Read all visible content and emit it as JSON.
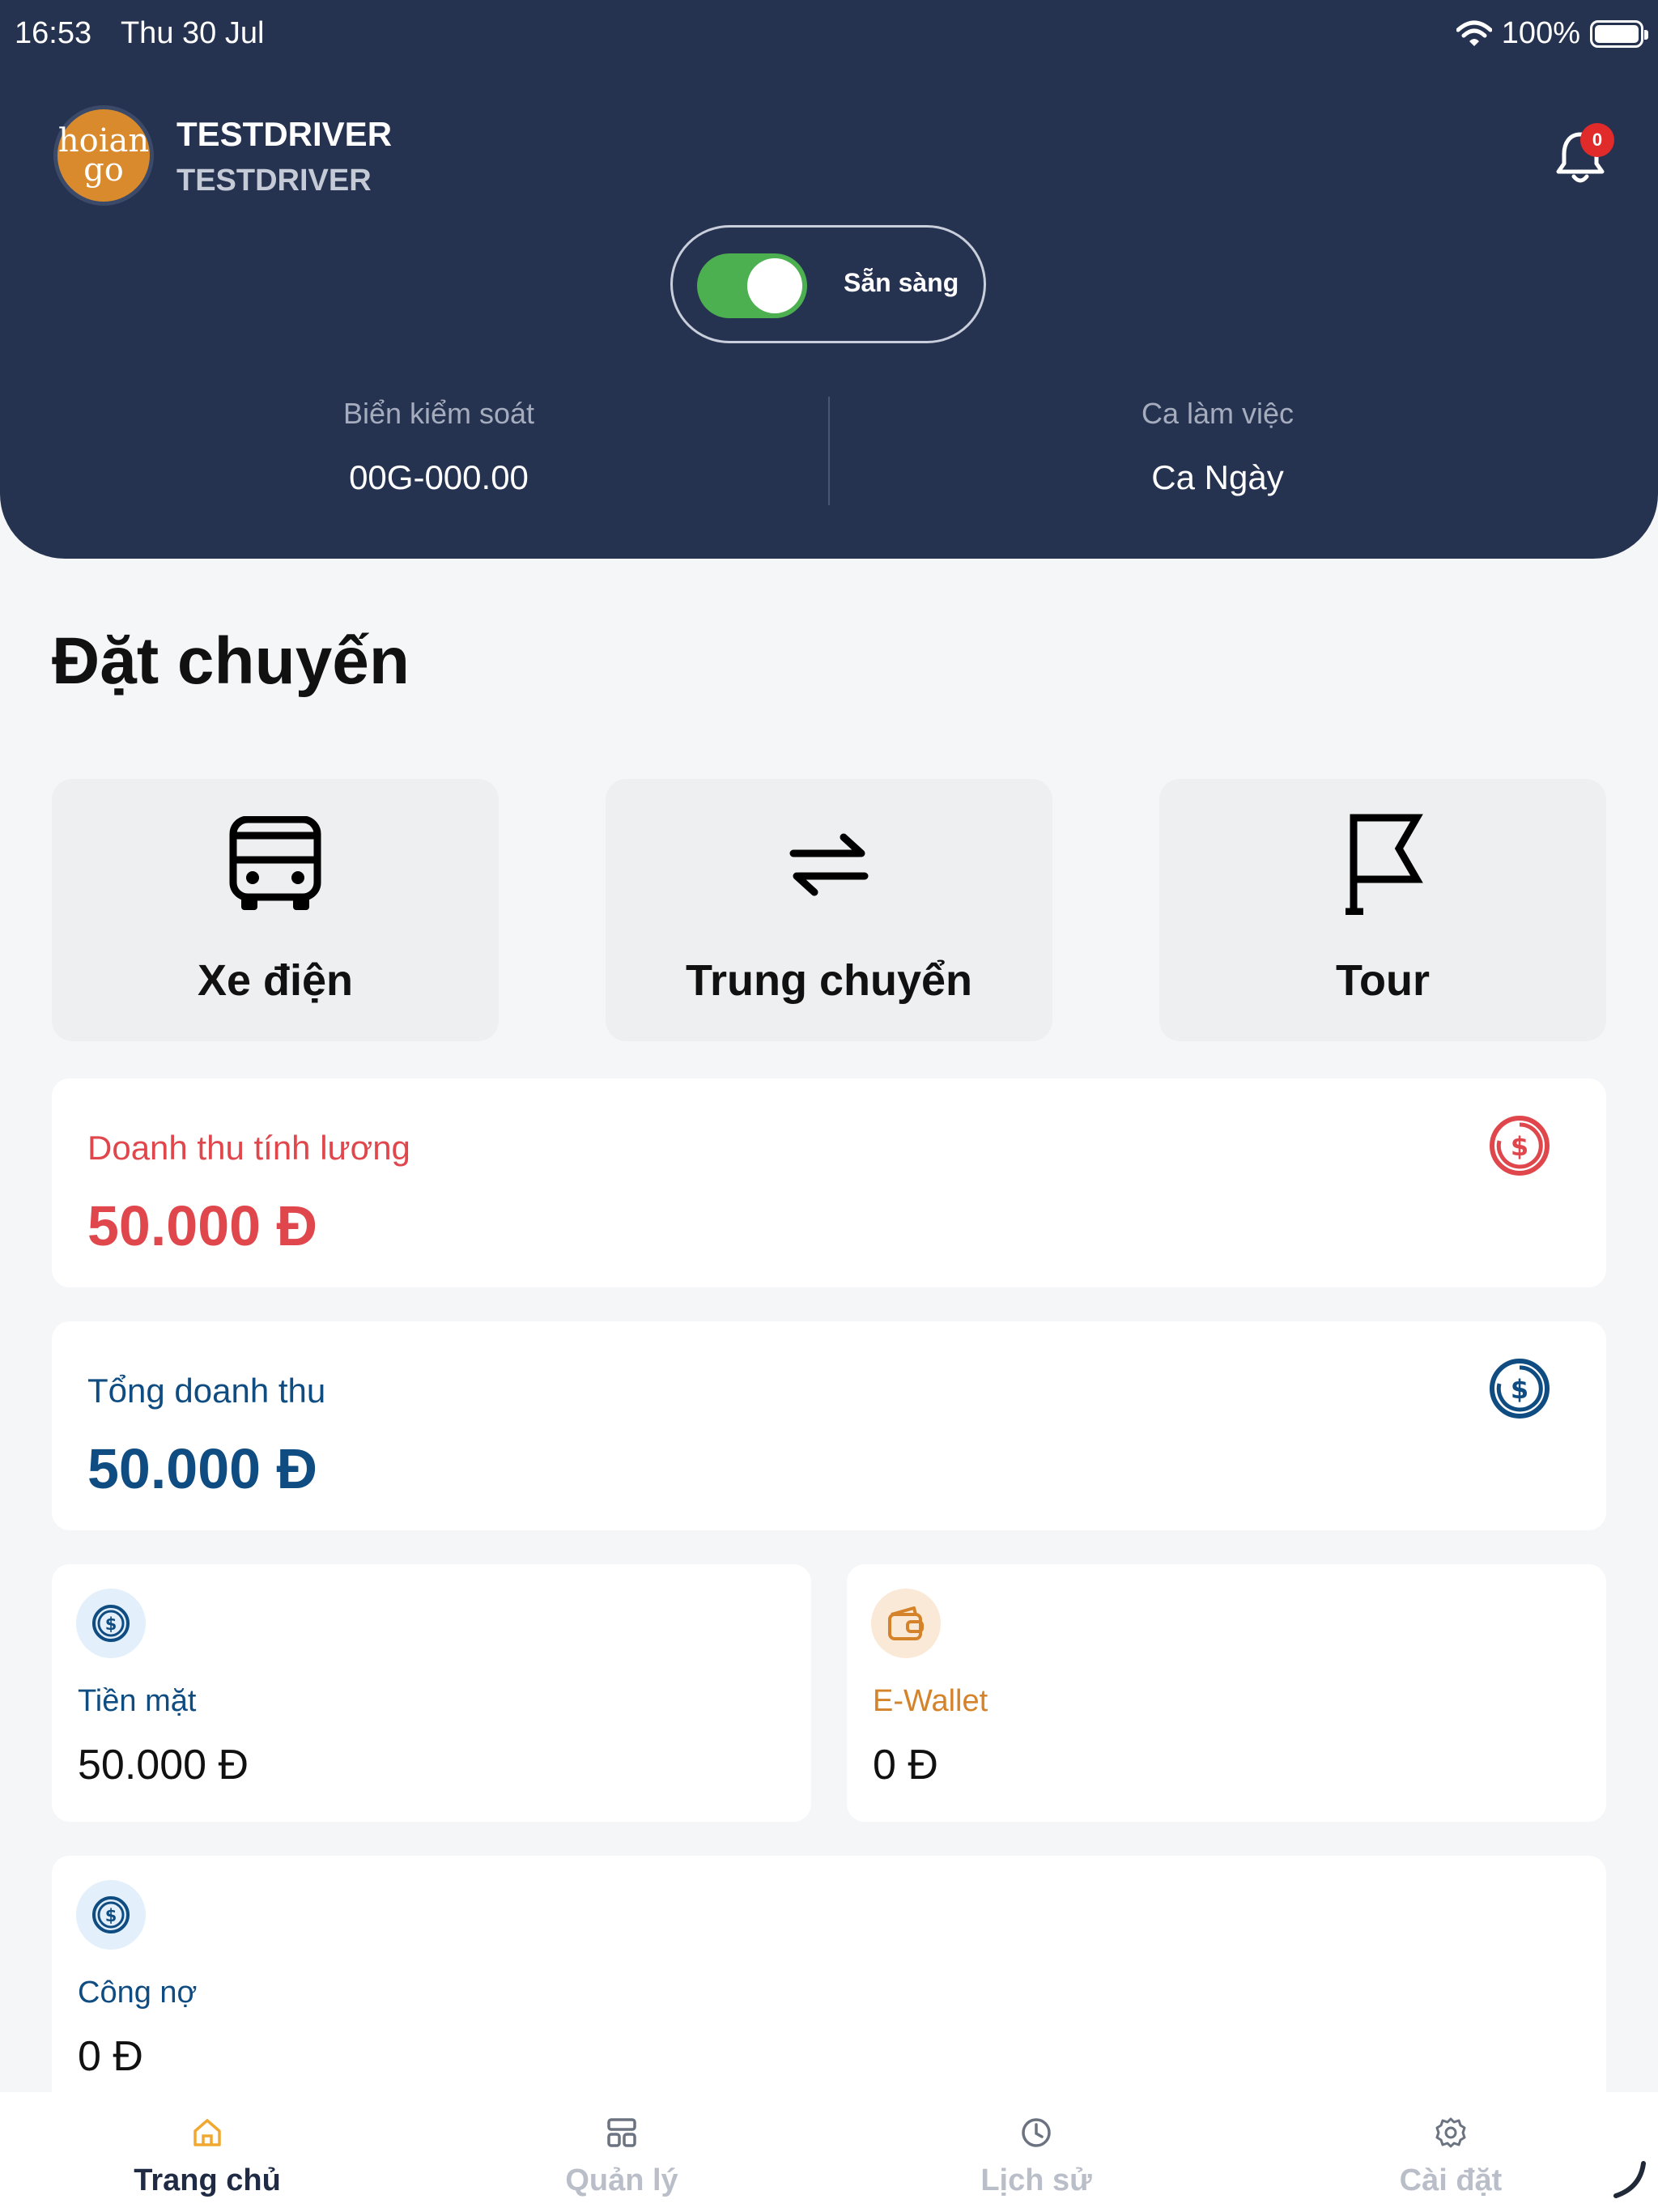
{
  "status_bar": {
    "time": "16:53",
    "date": "Thu 30 Jul",
    "battery": "100%"
  },
  "profile": {
    "logo_line1": "hoian",
    "logo_line2": "go",
    "name": "TESTDRIVER",
    "subtitle": "TESTDRIVER",
    "notification_count": "0"
  },
  "availability": {
    "label": "Sẵn sàng",
    "enabled": true
  },
  "vehicle": {
    "plate_label": "Biển kiểm soát",
    "plate_value": "00G-000.00"
  },
  "shift": {
    "label": "Ca làm việc",
    "value": "Ca Ngày"
  },
  "booking": {
    "title": "Đặt chuyến",
    "options": [
      {
        "label": "Xe điện",
        "icon": "bus-icon"
      },
      {
        "label": "Trung chuyển",
        "icon": "swap-arrows-icon"
      },
      {
        "label": "Tour",
        "icon": "flag-icon"
      }
    ]
  },
  "revenue": {
    "salary": {
      "title": "Doanh thu tính lương",
      "amount": "50.000 Đ",
      "color": "#e0474c"
    },
    "total": {
      "title": "Tổng doanh thu",
      "amount": "50.000 Đ",
      "color": "#0f4c81"
    }
  },
  "wallets": {
    "cash": {
      "title": "Tiền mặt",
      "amount": "50.000 Đ",
      "color": "#0f4c81"
    },
    "ewallet": {
      "title": "E-Wallet",
      "amount": "0 Đ",
      "color": "#d4832a"
    },
    "debt": {
      "title": "Công nợ",
      "amount": "0 Đ",
      "color": "#0f4c81"
    }
  },
  "nav": {
    "items": [
      {
        "label": "Trang chủ",
        "icon": "home-icon",
        "active": true
      },
      {
        "label": "Quản lý",
        "icon": "grid-icon",
        "active": false
      },
      {
        "label": "Lịch sử",
        "icon": "clock-icon",
        "active": false
      },
      {
        "label": "Cài đặt",
        "icon": "gear-icon",
        "active": false
      }
    ]
  }
}
